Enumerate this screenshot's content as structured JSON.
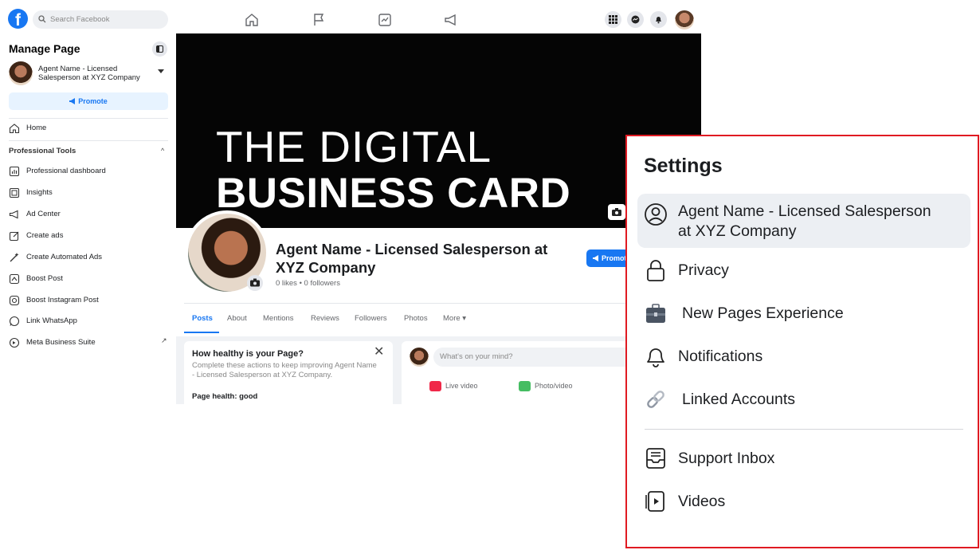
{
  "topbar": {
    "search_placeholder": "Search Facebook",
    "logo_letter": "f"
  },
  "sidebar": {
    "title": "Manage Page",
    "page_name": "Agent Name - Licensed Salesperson at XYZ Company",
    "promote_label": "Promote",
    "home_label": "Home",
    "section_title": "Professional Tools",
    "items": [
      {
        "label": "Professional dashboard",
        "icon": "dashboard-icon"
      },
      {
        "label": "Insights",
        "icon": "insights-icon"
      },
      {
        "label": "Ad Center",
        "icon": "megaphone-icon"
      },
      {
        "label": "Create ads",
        "icon": "edit-icon"
      },
      {
        "label": "Create Automated Ads",
        "icon": "magic-wand-icon"
      },
      {
        "label": "Boost Post",
        "icon": "boost-icon"
      },
      {
        "label": "Boost Instagram Post",
        "icon": "instagram-icon"
      },
      {
        "label": "Link WhatsApp",
        "icon": "whatsapp-icon"
      },
      {
        "label": "Meta Business Suite",
        "icon": "business-suite-icon"
      }
    ]
  },
  "cover": {
    "line1": "THE DIGITAL",
    "line2": "BUSINESS CARD"
  },
  "profile": {
    "name": "Agent Name - Licensed Salesperson at XYZ Company",
    "stats": "0 likes • 0 followers",
    "promote_label": "Promote"
  },
  "tabs": [
    "Posts",
    "About",
    "Mentions",
    "Reviews",
    "Followers",
    "Photos",
    "More ▾"
  ],
  "health_card": {
    "title": "How healthy is your Page?",
    "desc": "Complete these actions to keep improving Agent Name - Licensed Salesperson at XYZ Company.",
    "health": "Page health: good",
    "close": "✕"
  },
  "composer": {
    "placeholder": "What's on your mind?",
    "live_label": "Live video",
    "photo_label": "Photo/video",
    "live_color": "#f02849",
    "photo_color": "#45bd62"
  },
  "settings": {
    "title": "Settings",
    "account_label_line1": "Agent Name - Licensed Salesperson",
    "account_label_line2": "at XYZ Company",
    "items": [
      {
        "label": "Privacy",
        "icon": "lock-icon"
      },
      {
        "label": "New Pages Experience",
        "icon": "briefcase-icon"
      },
      {
        "label": "Notifications",
        "icon": "bell-icon"
      },
      {
        "label": "Linked Accounts",
        "icon": "link-icon"
      },
      {
        "label": "Support Inbox",
        "icon": "inbox-icon"
      },
      {
        "label": "Videos",
        "icon": "video-icon"
      }
    ],
    "border_color": "#e01a22"
  },
  "colors": {
    "brand": "#1877f2",
    "page_bg": "#f0f2f5"
  }
}
